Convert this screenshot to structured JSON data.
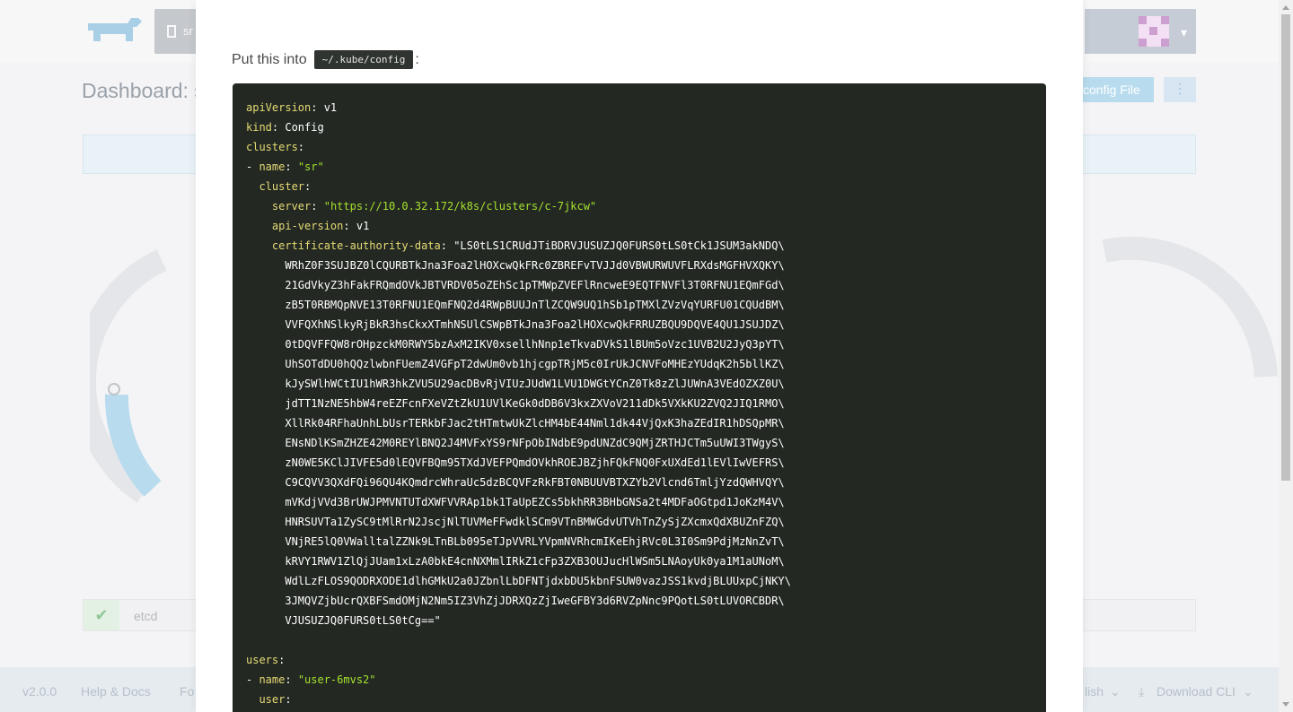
{
  "app": {
    "version": "v2.0.0",
    "dashboard_title": "Dashboard: sr",
    "cluster_name": "sr",
    "kubeconfig_button": "config File",
    "more_button": "⋮",
    "etcd_label": "etcd",
    "footer": {
      "version": "v2.0.0",
      "help": "Help & Docs",
      "forums": "Fo",
      "language": "lish",
      "download_cli": "Download CLI"
    }
  },
  "modal": {
    "instruction": "Put this into",
    "path": "~/.kube/config",
    "instruction_suffix": ":"
  },
  "kubeconfig": {
    "apiVersion_key": "apiVersion",
    "apiVersion_val": "v1",
    "kind_key": "kind",
    "kind_val": "Config",
    "clusters_key": "clusters",
    "cluster_name_key": "name",
    "cluster_name_val": "\"sr\"",
    "cluster_key": "cluster",
    "server_key": "server",
    "server_val": "\"https://10.0.32.172/k8s/clusters/c-7jkcw\"",
    "api_version_key": "api-version",
    "api_version_val": "v1",
    "ca_key": "certificate-authority-data",
    "ca_lines": [
      "\"LS0tLS1CRUdJTiBDRVJUSUZJQ0FURS0tLS0tCk1JSUM3akNDQ\\",
      "WRhZ0F3SUJBZ0lCQURBTkJna3Foa2lHOXcwQkFRc0ZBREFvTVJJd0VBWURWUVFLRXdsMGFHVXQKY\\",
      "21GdVkyZ3hFakFRQmdOVkJBTVRDV05oZEhSc1pTMWpZVEFlRncweE9EQTFNVFl3T0RFNU1EQmFGd\\",
      "zB5T0RBMQpNVE13T0RFNU1EQmFNQ2d4RWpBUUJnTlZCQW9UQ1hSb1pTMXlZVzVqYURFU01CQUdBM\\",
      "VVFQXhNSlkyRjBkR3hsCkxXTmhNSUlCSWpBTkJna3Foa2lHOXcwQkFRRUZBQU9DQVE4QU1JSUJDZ\\",
      "0tDQVFFQW8rOHpzckM0RWY5bzAxM2IKV0xsellhNnp1eTkvaDVkS1lBUm5oVzc1UVB2U2JyQ3pYT\\",
      "UhSOTdDU0hQQzlwbnFUemZ4VGFpT2dwUm0vb1hjcgpTRjM5c0IrUkJCNVFoMHEzYUdqK2h5bllKZ\\",
      "kJySWlhWCtIU1hWR3hkZVU5U29acDBvRjVIUzJUdW1LVU1DWGtYCnZ0Tk8zZlJUWnA3VEdOZXZ0U\\",
      "jdTT1NzNE5hbW4reEZFcnFXeVZtZkU1UVlKeGk0dDB6V3kxZXVoV211dDk5VXkKU2ZVQ2JIQ1RMO\\",
      "XllRk04RFhaUnhLbUsrTERkbFJac2tHTmtwUkZlcHM4bE44Nml1dk44VjQxK3haZEdIR1hDSQpMR\\",
      "ENsNDlKSmZHZE42M0REYlBNQ2J4MVFxYS9rNFpObINdbE9pdUNZdC9QMjZRTHJCTm5uUWI3TWgyS\\",
      "zN0WE5KClJIVFE5d0lEQVFBQm95TXdJVEFPQmdOVkhROEJBZjhFQkFNQ0FxUXdEd1lEVlIwVEFRS\\",
      "C9CQVV3QXdFQi96QU4KQmdrcWhraUc5dzBCQVFzRkFBT0NBUUVBTXZYb2Vlcnd6TmljYzdQWHVQY\\",
      "mVKdjVVd3BrUWJPMVNTUTdXWFVVRAp1bk1TaUpEZCs5bkhRR3BHbGNSa2t4MDFaOGtpd1JoKzM4V\\",
      "HNRSUVTa1ZySC9tMlRrN2JscjNlTUVMeFFwdklSCm9VTnBMWGdvUTVhTnZySjZXcmxQdXBUZnFZQ\\",
      "VNjRE5lQ0VWalltalZZNk9LTnBLb095eTJpVVRLYVpmNVRhcmIKeEhjRVc0L3I0Sm9PdjMzNnZvT\\",
      "kRVY1RWV1ZlQjJUam1xLzA0bkE4cnNXMmlIRkZ1cFp3ZXB3OUJucHlWSm5LNAoyUk0ya1M1aUNoM\\",
      "WdlLzFLOS9QODRXODE1dlhGMkU2a0JZbnlLbDFNTjdxbDU5kbnFSUW0vazJSS1kvdjBLUUxpCjNKY\\",
      "3JMQVZjbUcrQXBFSmdOMjN2Nm5IZ3VhZjJDRXQzZjIweGFBY3d6RVZpNnc9PQotLS0tLUVORCBDR\\",
      "VJUSUZJQ0FURS0tLS0tCg==\""
    ],
    "users_key": "users",
    "user_name_key": "name",
    "user_name_val": "\"user-6mvs2\"",
    "user_key": "user"
  },
  "colors": {
    "code_bg": "#232823",
    "yaml_key": "#e6db74",
    "yaml_string": "#a6e22e",
    "accent_blue": "#b8dbee"
  }
}
